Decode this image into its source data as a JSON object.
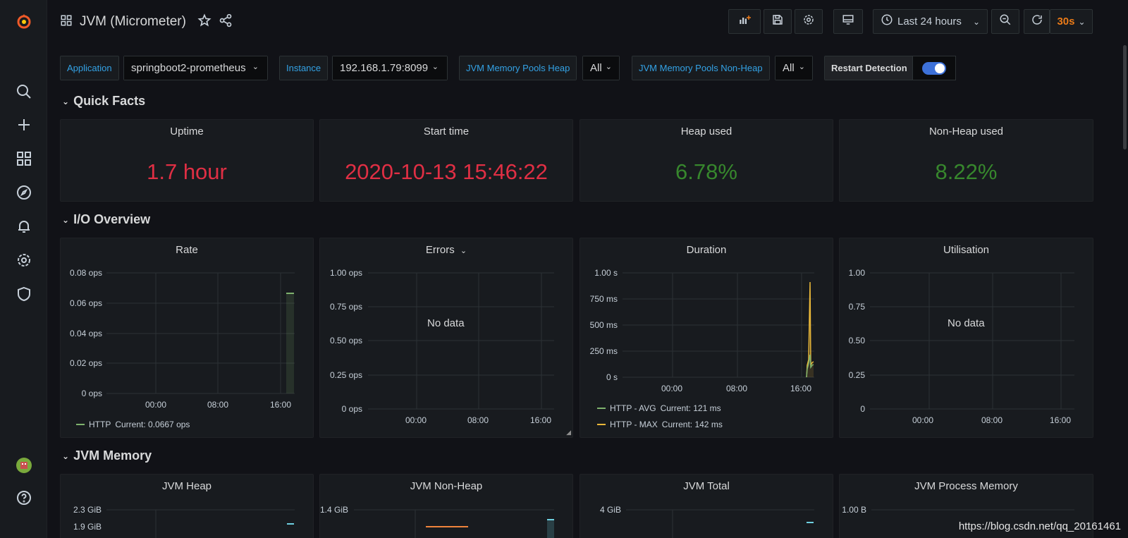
{
  "dashboard": {
    "title": "JVM (Micrometer)"
  },
  "toolbar": {
    "time_range": "Last 24 hours",
    "refresh_interval": "30s"
  },
  "variables": [
    {
      "label": "Application",
      "value": "springboot2-prometheus"
    },
    {
      "label": "Instance",
      "value": "192.168.1.79:8099"
    },
    {
      "label": "JVM Memory Pools Heap",
      "value": "All"
    },
    {
      "label": "JVM Memory Pools Non-Heap",
      "value": "All"
    }
  ],
  "restart_detection": {
    "label": "Restart Detection",
    "enabled": true
  },
  "rows": {
    "quick_facts": "Quick Facts",
    "io_overview": "I/O Overview",
    "jvm_memory": "JVM Memory"
  },
  "stats": [
    {
      "title": "Uptime",
      "value": "1.7 hour",
      "color": "#e02f44"
    },
    {
      "title": "Start time",
      "value": "2020-10-13 15:46:22",
      "color": "#e02f44"
    },
    {
      "title": "Heap used",
      "value": "6.78%",
      "color": "#37872d"
    },
    {
      "title": "Non-Heap used",
      "value": "8.22%",
      "color": "#37872d"
    }
  ],
  "io_panels": {
    "rate": {
      "title": "Rate",
      "yticks": [
        "0.08 ops",
        "0.06 ops",
        "0.04 ops",
        "0.02 ops",
        "0 ops"
      ],
      "xticks": [
        "00:00",
        "08:00",
        "16:00"
      ],
      "legend": [
        {
          "name": "HTTP",
          "current": "Current: 0.0667 ops",
          "color": "#7eb26d"
        }
      ]
    },
    "errors": {
      "title": "Errors",
      "yticks": [
        "1.00 ops",
        "0.75 ops",
        "0.50 ops",
        "0.25 ops",
        "0 ops"
      ],
      "xticks": [
        "00:00",
        "08:00",
        "16:00"
      ],
      "no_data": "No data"
    },
    "duration": {
      "title": "Duration",
      "yticks": [
        "1.00 s",
        "750 ms",
        "500 ms",
        "250 ms",
        "0 s"
      ],
      "xticks": [
        "00:00",
        "08:00",
        "16:00"
      ],
      "legend": [
        {
          "name": "HTTP - AVG",
          "current": "Current: 121 ms",
          "color": "#7eb26d"
        },
        {
          "name": "HTTP - MAX",
          "current": "Current: 142 ms",
          "color": "#eab839"
        }
      ]
    },
    "utilisation": {
      "title": "Utilisation",
      "yticks": [
        "1.00",
        "0.75",
        "0.50",
        "0.25",
        "0"
      ],
      "xticks": [
        "00:00",
        "08:00",
        "16:00"
      ],
      "no_data": "No data"
    }
  },
  "memory_panels": [
    {
      "title": "JVM Heap",
      "ytick": "2.3 GiB",
      "ytick2": "1.9 GiB"
    },
    {
      "title": "JVM Non-Heap",
      "ytick": "1.4 GiB"
    },
    {
      "title": "JVM Total",
      "ytick": "4 GiB"
    },
    {
      "title": "JVM Process Memory",
      "ytick": "1.00 B"
    }
  ],
  "watermark": "https://blog.csdn.net/qq_20161461"
}
